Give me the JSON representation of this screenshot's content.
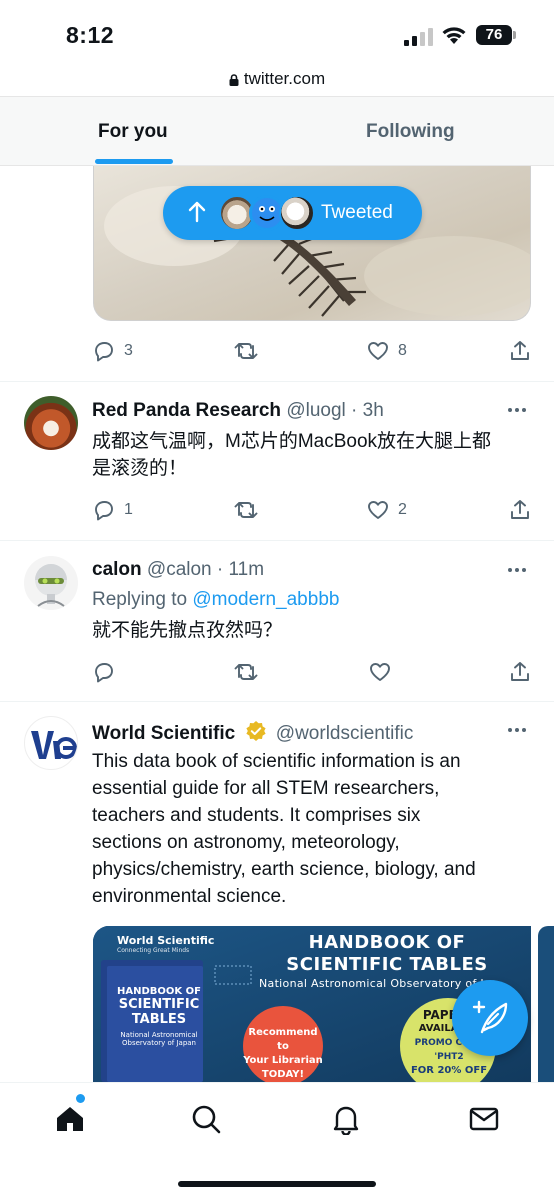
{
  "status_bar": {
    "time": "8:12",
    "battery": "76",
    "icons": [
      "signal-icon",
      "wifi-icon",
      "battery-icon"
    ]
  },
  "browser": {
    "url": "twitter.com"
  },
  "tabs": [
    {
      "label": "For you",
      "selected": true
    },
    {
      "label": "Following",
      "selected": false
    }
  ],
  "tweeted_pill": {
    "label": "Tweeted"
  },
  "tweets": [
    {
      "id": "prev",
      "replies": "3",
      "retweets": "",
      "likes": "8"
    },
    {
      "id": "red-panda",
      "name": "Red Panda Research",
      "handle": "@luogl",
      "time": "· 3h",
      "text_line1": "成都这气温啊，M芯片的MacBook放在大腿上都",
      "text_line2": "是滚烫的！",
      "replies": "1",
      "retweets": "",
      "likes": "2"
    },
    {
      "id": "calon",
      "name": "calon",
      "handle": "@calon",
      "time": "· 11m",
      "replying_prefix": "Replying to",
      "replying_to": "@modern_abbbb",
      "text": "就不能先撤点孜然吗？",
      "replies": "",
      "retweets": "",
      "likes": ""
    },
    {
      "id": "world-scientific",
      "name": "World Scientific",
      "handle": "@worldscientific",
      "verified": true,
      "text_lines": [
        "This data book of scientific information is an",
        "essential guide for all STEM researchers,",
        "teachers and students. It comprises six",
        "sections on astronomy, meteorology,",
        "physics/chemistry, earth science, biology, and",
        "environmental science."
      ],
      "card": {
        "brand": "World Scientific",
        "brand_tag": "Connecting Great Minds",
        "title_line1": "HANDBOOK OF",
        "title_line2": "SCIENTIFIC TABLES",
        "subtitle": "National Astronomical Observatory of J",
        "book_line1": "HANDBOOK OF",
        "book_line2": "SCIENTIFIC",
        "book_line3": "TABLES",
        "book_sub1": "National Astronomical",
        "book_sub2": "Observatory of Japan",
        "circle1_line1": "Recommend to",
        "circle1_line2": "Your Librarian",
        "circle1_line3": "TODAY!",
        "circle2_line1": "PAPERB",
        "circle2_line2": "AVAILABLE",
        "circle2_line3": "PROMO CODE 'PHT2",
        "circle2_line4": "FOR 20% OFF"
      }
    }
  ],
  "colors": {
    "accent": "#1d9bf0",
    "text": "#0f1419",
    "secondary": "#536471",
    "card_bg": "#1a4e7a",
    "card_accent": "#e9543d",
    "card_green": "#d8e36a"
  },
  "bottom_nav": [
    "home-icon",
    "search-icon",
    "notifications-icon",
    "messages-icon"
  ]
}
